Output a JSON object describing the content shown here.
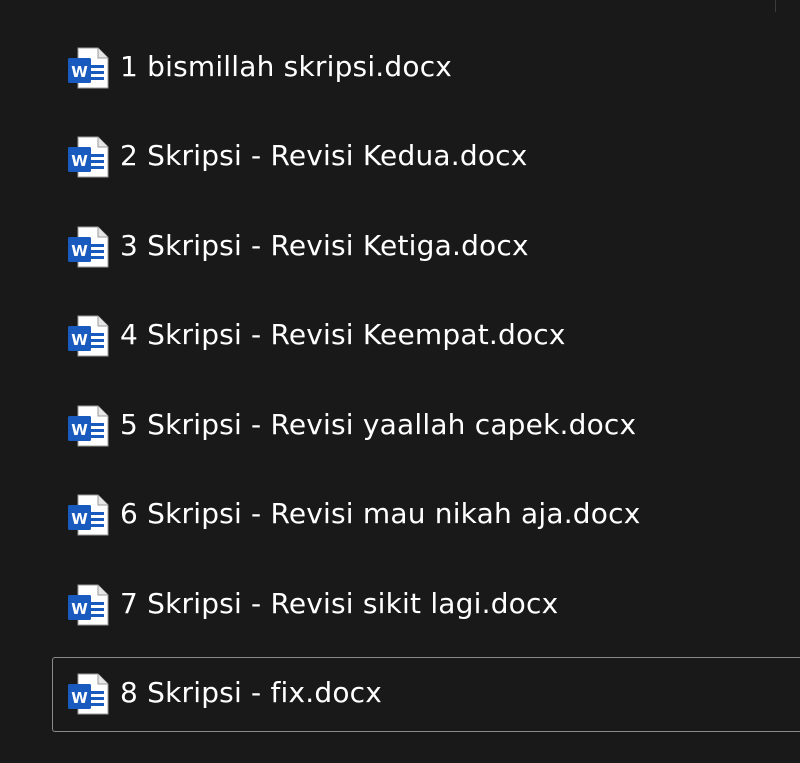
{
  "files": [
    {
      "name": "1 bismillah skripsi.docx",
      "icon": "word-document-icon"
    },
    {
      "name": "2 Skripsi - Revisi Kedua.docx",
      "icon": "word-document-icon"
    },
    {
      "name": "3 Skripsi - Revisi Ketiga.docx",
      "icon": "word-document-icon"
    },
    {
      "name": "4 Skripsi - Revisi Keempat.docx",
      "icon": "word-document-icon"
    },
    {
      "name": "5 Skripsi - Revisi yaallah capek.docx",
      "icon": "word-document-icon"
    },
    {
      "name": "6 Skripsi - Revisi mau nikah aja.docx",
      "icon": "word-document-icon"
    },
    {
      "name": "7 Skripsi - Revisi sikit lagi.docx",
      "icon": "word-document-icon"
    },
    {
      "name": "8 Skripsi - fix.docx",
      "icon": "word-document-icon",
      "selected": true
    }
  ],
  "colors": {
    "background": "#191919",
    "text": "#ffffff",
    "word_blue": "#185abd",
    "selection_border": "#8a8a8a"
  }
}
